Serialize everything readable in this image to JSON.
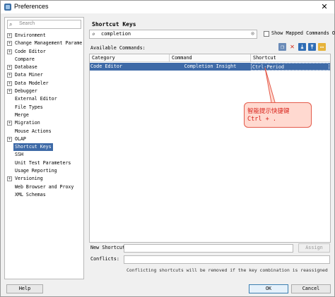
{
  "window": {
    "title": "Preferences",
    "close": "✕"
  },
  "left": {
    "search_placeholder": "Search",
    "items": [
      {
        "label": "Environment",
        "expandable": true
      },
      {
        "label": "Change Management Parame",
        "expandable": true
      },
      {
        "label": "Code Editor",
        "expandable": true
      },
      {
        "label": "Compare",
        "expandable": false
      },
      {
        "label": "Database",
        "expandable": true
      },
      {
        "label": "Data Miner",
        "expandable": true
      },
      {
        "label": "Data Modeler",
        "expandable": true
      },
      {
        "label": "Debugger",
        "expandable": true
      },
      {
        "label": "External Editor",
        "expandable": false
      },
      {
        "label": "File Types",
        "expandable": false
      },
      {
        "label": "Merge",
        "expandable": false
      },
      {
        "label": "Migration",
        "expandable": true
      },
      {
        "label": "Mouse Actions",
        "expandable": false
      },
      {
        "label": "OLAP",
        "expandable": true
      },
      {
        "label": "Shortcut Keys",
        "expandable": false,
        "selected": true
      },
      {
        "label": "SSH",
        "expandable": false
      },
      {
        "label": "Unit Test Parameters",
        "expandable": false
      },
      {
        "label": "Usage Reporting",
        "expandable": false
      },
      {
        "label": "Versioning",
        "expandable": true
      },
      {
        "label": "Web Browser and Proxy",
        "expandable": false
      },
      {
        "label": "XML Schemas",
        "expandable": false
      }
    ]
  },
  "main": {
    "title": "Shortcut Keys",
    "search_value": "completion",
    "show_mapped_label": "Show Mapped Commands Only",
    "available_label": "Available Commands:",
    "columns": [
      "Category",
      "Command",
      "Shortcut"
    ],
    "rows": [
      {
        "category": "Code Editor",
        "command": "Completion Insight",
        "shortcut": "Ctrl-Period"
      }
    ],
    "callout": {
      "line1": "智能提示快捷键",
      "line2": "Ctrl + ."
    },
    "new_shortcut_label": "New Shortcut:",
    "assign_label": "Assign",
    "conflicts_label": "Conflicts:",
    "conflict_note": "Conflicting shortcuts will be removed if the key combination is reassigned"
  },
  "buttons": {
    "help": "Help",
    "ok": "OK",
    "cancel": "Cancel"
  },
  "colors": {
    "selection": "#3e6aa7",
    "callout_border": "#e45a4a",
    "callout_text": "#d8221a"
  }
}
